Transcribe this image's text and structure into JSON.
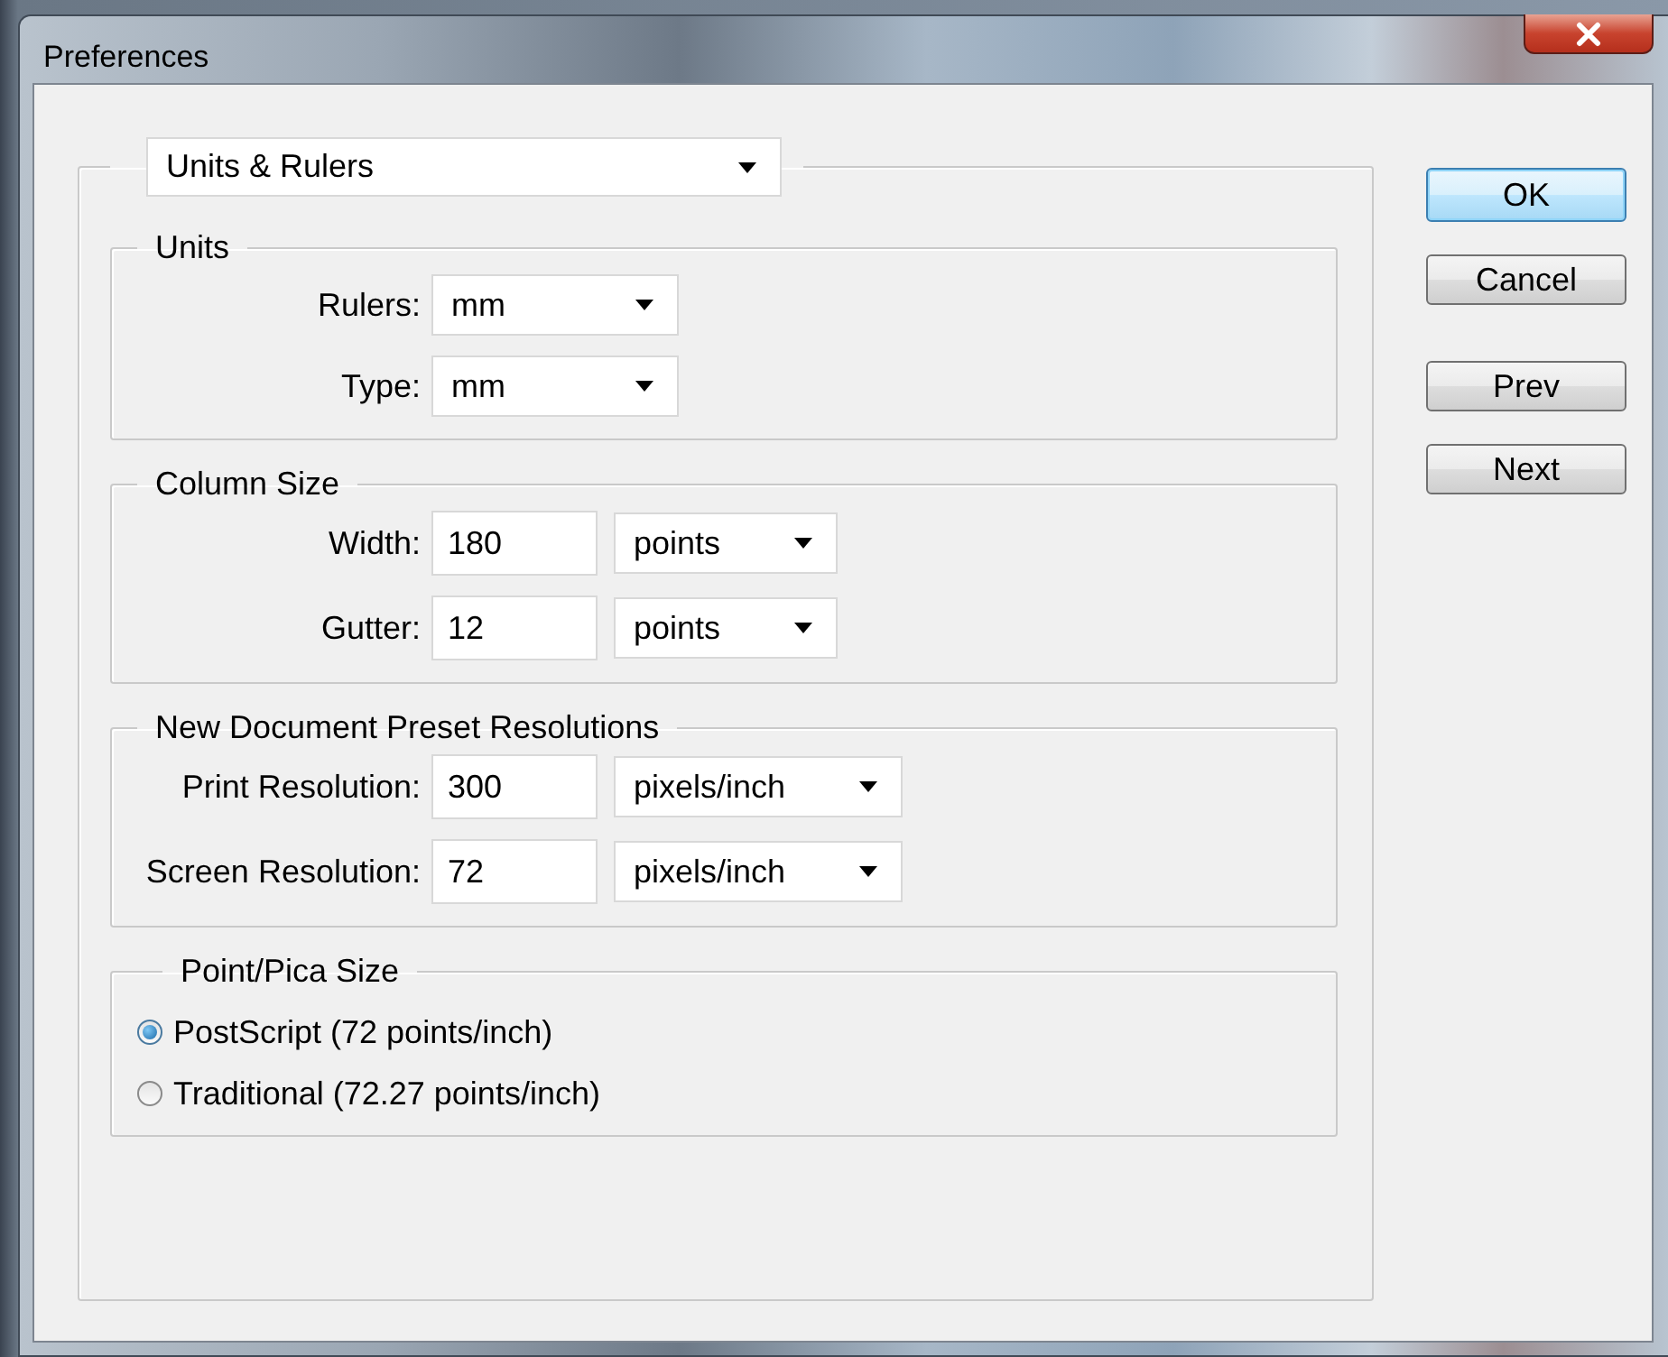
{
  "window": {
    "title": "Preferences"
  },
  "category": {
    "value": "Units & Rulers"
  },
  "groups": [
    {
      "title": "Units",
      "rows": [
        {
          "kind": "select",
          "label": "Rulers:",
          "select": "mm"
        },
        {
          "kind": "select",
          "label": "Type:",
          "select": "mm"
        }
      ]
    },
    {
      "title": "Column Size",
      "rows": [
        {
          "kind": "input_select",
          "label": "Width:",
          "value": "180",
          "select": "points"
        },
        {
          "kind": "input_select",
          "label": "Gutter:",
          "value": "12",
          "select": "points"
        }
      ]
    },
    {
      "title": "New Document Preset Resolutions",
      "rows": [
        {
          "kind": "input_select",
          "label": "Print Resolution:",
          "value": "300",
          "select": "pixels/inch"
        },
        {
          "kind": "input_select",
          "label": "Screen Resolution:",
          "value": "72",
          "select": "pixels/inch"
        }
      ]
    }
  ],
  "point_pica": {
    "title": "Point/Pica Size",
    "options": [
      {
        "label": "PostScript (72 points/inch)",
        "selected": true
      },
      {
        "label": "Traditional (72.27 points/inch)",
        "selected": false
      }
    ]
  },
  "buttons": [
    {
      "label": "OK",
      "default": true
    },
    {
      "label": "Cancel",
      "default": false
    },
    {
      "label": "Prev",
      "default": false
    },
    {
      "label": "Next",
      "default": false
    }
  ]
}
